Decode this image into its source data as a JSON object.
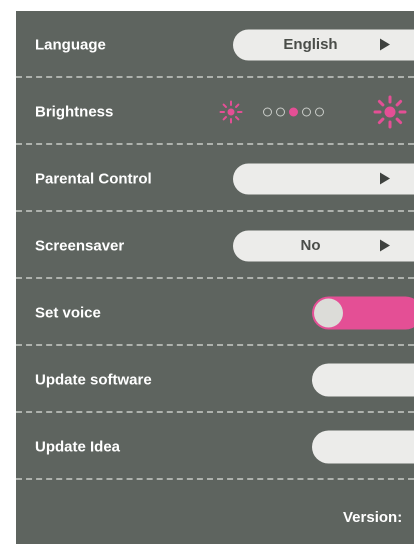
{
  "settings": {
    "language": {
      "label": "Language",
      "value": "English",
      "icon": "play-arrow-icon"
    },
    "brightness": {
      "label": "Brightness",
      "level": 3,
      "levels": 5,
      "icon_low": "sun-small-icon",
      "icon_high": "sun-large-icon"
    },
    "parental_control": {
      "label": "Parental Control",
      "value": "",
      "icon": "play-arrow-icon"
    },
    "screensaver": {
      "label": "Screensaver",
      "value": "No",
      "icon": "play-arrow-icon"
    },
    "set_voice": {
      "label": "Set voice",
      "enabled": true
    },
    "update_software": {
      "label": "Update software"
    },
    "update_idea": {
      "label": "Update Idea"
    }
  },
  "footer": {
    "version_label": "Version:"
  },
  "colors": {
    "panel": "#5e645f",
    "accent": "#e44f95",
    "pill": "#ececea",
    "divider": "#aeb2ad"
  }
}
